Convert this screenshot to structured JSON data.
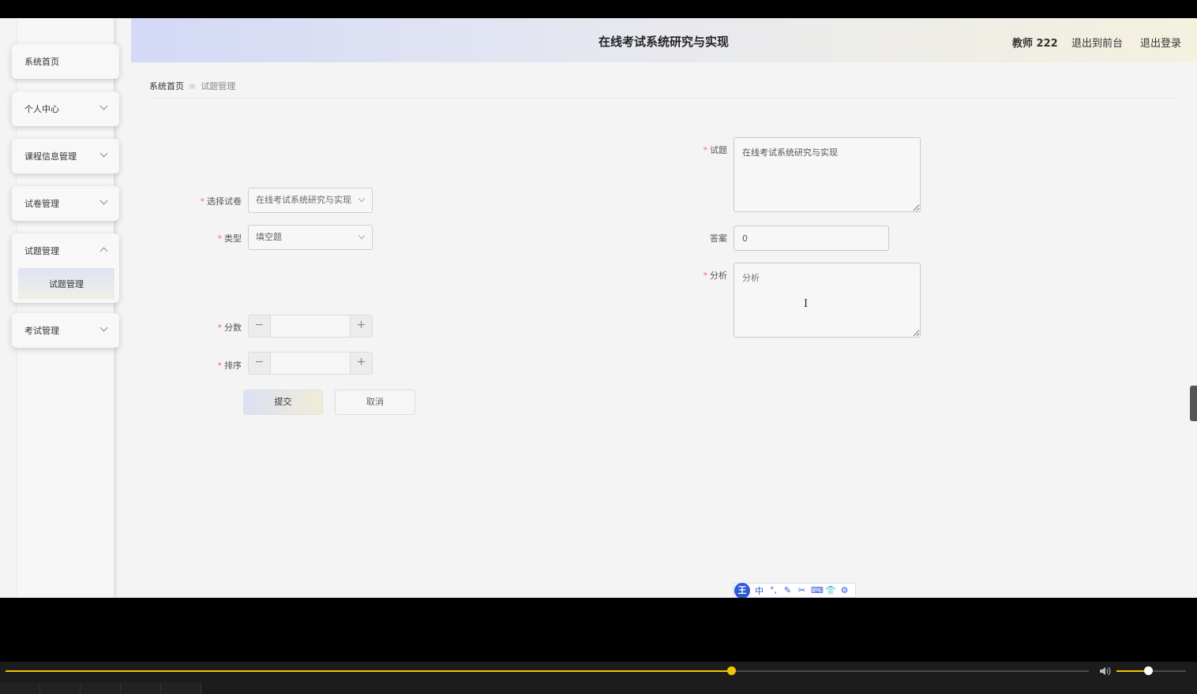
{
  "header": {
    "title": "在线考试系统研究与实现",
    "user": "教师 222",
    "back_front": "退出到前台",
    "logout": "退出登录"
  },
  "sidebar": {
    "home": "系统首页",
    "menus": [
      "个人中心",
      "课程信息管理",
      "试卷管理",
      "试题管理",
      "考试管理"
    ],
    "active_sub": "试题管理"
  },
  "breadcrumb": {
    "home": "系统首页",
    "separator": "≡",
    "current": "试题管理"
  },
  "form": {
    "paper_label": "选择试卷",
    "paper_value": "在线考试系统研究与实现",
    "type_label": "类型",
    "type_value": "填空题",
    "score_label": "分数",
    "order_label": "排序",
    "question_label": "试题",
    "question_value": "在线考试系统研究与实现",
    "answer_label": "答案",
    "answer_value": "0",
    "analysis_label": "分析",
    "analysis_placeholder": "分析",
    "required_mark": "*",
    "submit": "提交",
    "cancel": "取消"
  },
  "stepper": {
    "minus": "−",
    "plus": "+"
  },
  "ime_toolbar": {
    "logo": "王",
    "items": [
      "中",
      "°,",
      "✎",
      "✂",
      "⌨",
      "👕",
      "⚙"
    ]
  },
  "player": {
    "progress_fraction": 0.67,
    "volume_fraction": 0.45,
    "volume_icon": "speaker-icon"
  }
}
